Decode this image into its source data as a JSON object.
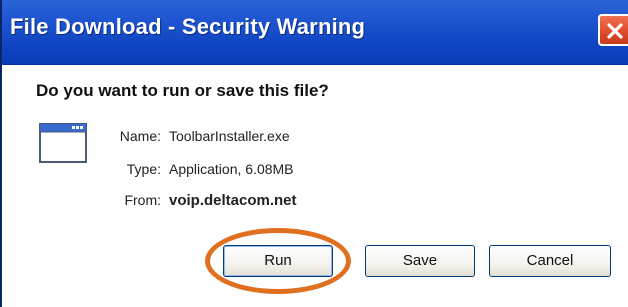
{
  "window": {
    "title": "File Download - Security Warning"
  },
  "main": {
    "question": "Do you want to run or save this file?",
    "file": {
      "icon": "application-window-icon",
      "name_label": "Name:",
      "name": "ToolbarInstaller.exe",
      "type_label": "Type:",
      "type": "Application, 6.08MB",
      "from_label": "From:",
      "from": "voip.deltacom.net"
    }
  },
  "buttons": {
    "run": "Run",
    "save": "Save",
    "cancel": "Cancel"
  },
  "annotation": {
    "highlight_color": "#e07020",
    "highlight_target": "run-button"
  },
  "colors": {
    "titlebar": "#0f45c2",
    "close_button": "#e0502e",
    "dialog_bg": "#ffffff"
  }
}
